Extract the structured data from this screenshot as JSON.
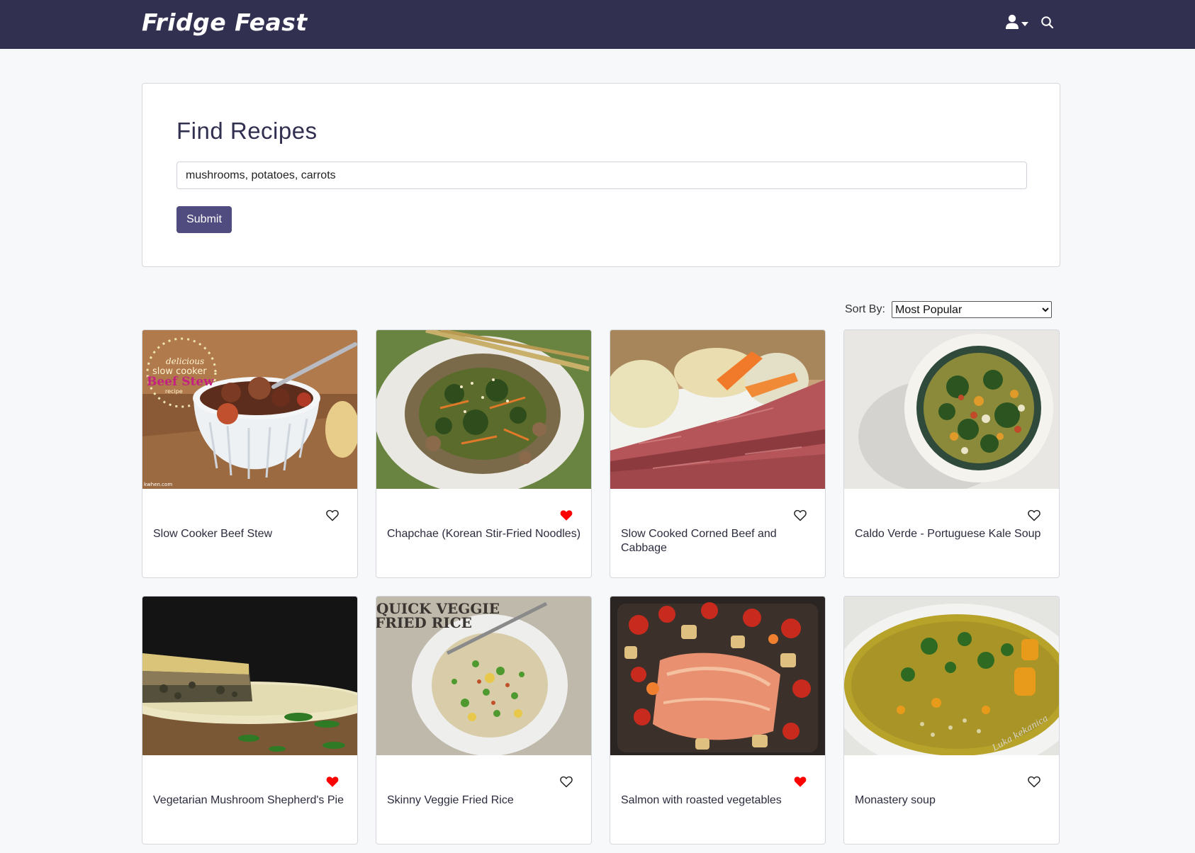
{
  "app": {
    "brand": "Fridge Feast"
  },
  "colors": {
    "navbar": "#323050",
    "primary_button": "#504c80",
    "favorite_active": "#ff0000",
    "page_background": "#f7f8f9"
  },
  "navbar": {
    "user_icon": "user-icon",
    "user_caret_icon": "caret-down-icon",
    "search_icon": "search-icon"
  },
  "search": {
    "title": "Find Recipes",
    "input_value": "mushrooms, potatoes, carrots",
    "submit_label": "Submit"
  },
  "sort": {
    "label": "Sort By:",
    "selected": "Most Popular"
  },
  "recipes": [
    {
      "title": "Slow Cooker Beef Stew",
      "favorited": false,
      "image_text": [
        "delicious",
        "slow cooker",
        "Beef Stew",
        "recipe",
        "kwhen.com"
      ]
    },
    {
      "title": "Chapchae (Korean Stir-Fried Noodles)",
      "favorited": true
    },
    {
      "title": "Slow Cooked Corned Beef and Cabbage",
      "favorited": false
    },
    {
      "title": "Caldo Verde - Portuguese Kale Soup",
      "favorited": false
    },
    {
      "title": "Vegetarian Mushroom Shepherd's Pie",
      "favorited": true
    },
    {
      "title": "Skinny Veggie Fried Rice",
      "favorited": false,
      "image_text": [
        "QUICK VEGGIE",
        "FRIED RICE"
      ]
    },
    {
      "title": "Salmon with roasted vegetables",
      "favorited": true
    },
    {
      "title": "Monastery soup",
      "favorited": false,
      "image_text": [
        "Luka kekanica"
      ]
    }
  ]
}
